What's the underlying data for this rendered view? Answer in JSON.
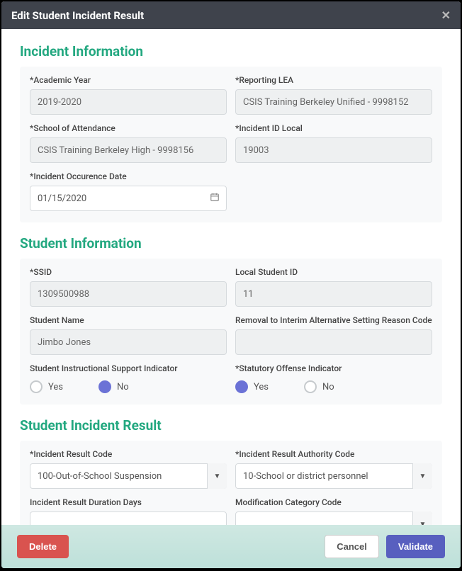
{
  "modal": {
    "title": "Edit Student Incident Result"
  },
  "sections": {
    "incident": {
      "title": "Incident Information",
      "academic_year": {
        "label": "*Academic Year",
        "value": "2019-2020"
      },
      "reporting_lea": {
        "label": "*Reporting LEA",
        "value": "CSIS Training Berkeley Unified - 9998152"
      },
      "school": {
        "label": "*School of Attendance",
        "value": "CSIS Training Berkeley High - 9998156"
      },
      "incident_id": {
        "label": "*Incident ID Local",
        "value": "19003"
      },
      "occurrence": {
        "label": "*Incident Occurence Date",
        "value": "01/15/2020"
      }
    },
    "student": {
      "title": "Student Information",
      "ssid": {
        "label": "*SSID",
        "value": "1309500988"
      },
      "local_id": {
        "label": "Local Student ID",
        "value": "11"
      },
      "name": {
        "label": "Student Name",
        "value": "Jimbo Jones"
      },
      "removal": {
        "label": "Removal to Interim Alternative Setting Reason Code",
        "value": ""
      },
      "support": {
        "label": "Student Instructional Support Indicator",
        "yes": "Yes",
        "no": "No",
        "selected": "no"
      },
      "statutory": {
        "label": "*Statutory Offense Indicator",
        "yes": "Yes",
        "no": "No",
        "selected": "yes"
      }
    },
    "result": {
      "title": "Student Incident Result",
      "result_code": {
        "label": "*Incident Result Code",
        "value": "100-Out-of-School Suspension"
      },
      "authority": {
        "label": "*Incident Result Authority Code",
        "value": "10-School or district personnel"
      },
      "duration": {
        "label": "Incident Result Duration Days",
        "value": ""
      },
      "mod_category": {
        "label": "Modification Category Code",
        "value": ""
      }
    }
  },
  "footer": {
    "delete": "Delete",
    "cancel": "Cancel",
    "validate": "Validate"
  }
}
